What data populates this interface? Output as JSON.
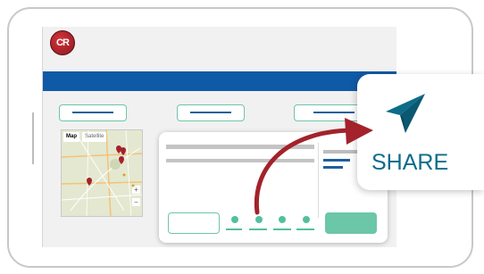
{
  "app": {
    "logo_text": "CR"
  },
  "map": {
    "tab_map": "Map",
    "tab_satellite": "Satellite",
    "zoom_in": "+",
    "zoom_out": "−"
  },
  "share": {
    "label": "SHARE"
  },
  "icons": {
    "share": "paper-plane-icon",
    "map_pin": "map-pin-icon",
    "arrow": "curved-arrow-icon"
  },
  "colors": {
    "accent_blue": "#0f5aa6",
    "accent_green": "#6cc6a8",
    "brand_red": "#a3222b",
    "share_teal": "#0d6c8a"
  }
}
